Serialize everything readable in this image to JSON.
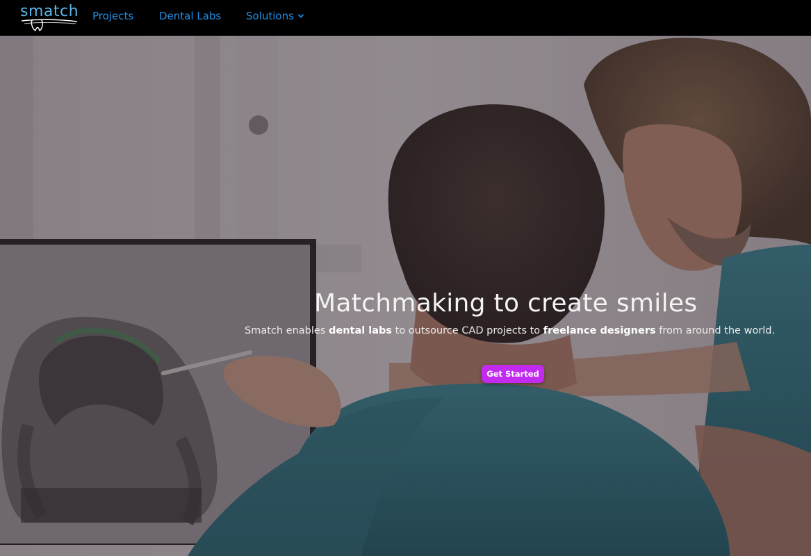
{
  "brand": {
    "logo_text": "smatch",
    "accent": "#58b6e8"
  },
  "nav": {
    "items": [
      {
        "label": "Projects"
      },
      {
        "label": "Dental Labs"
      },
      {
        "label": "Solutions",
        "icon": "chevron-down-icon"
      }
    ],
    "link_color": "#1f8fe6"
  },
  "hero": {
    "title": "Matchmaking to create smiles",
    "subtitle": {
      "part1": "Smatch enables ",
      "bold1": "dental labs",
      "part2": " to outsource CAD projects to ",
      "bold2": "freelance designers",
      "part3": " from around the world."
    },
    "cta_label": "Get Started",
    "cta_color": "#c22af0"
  }
}
